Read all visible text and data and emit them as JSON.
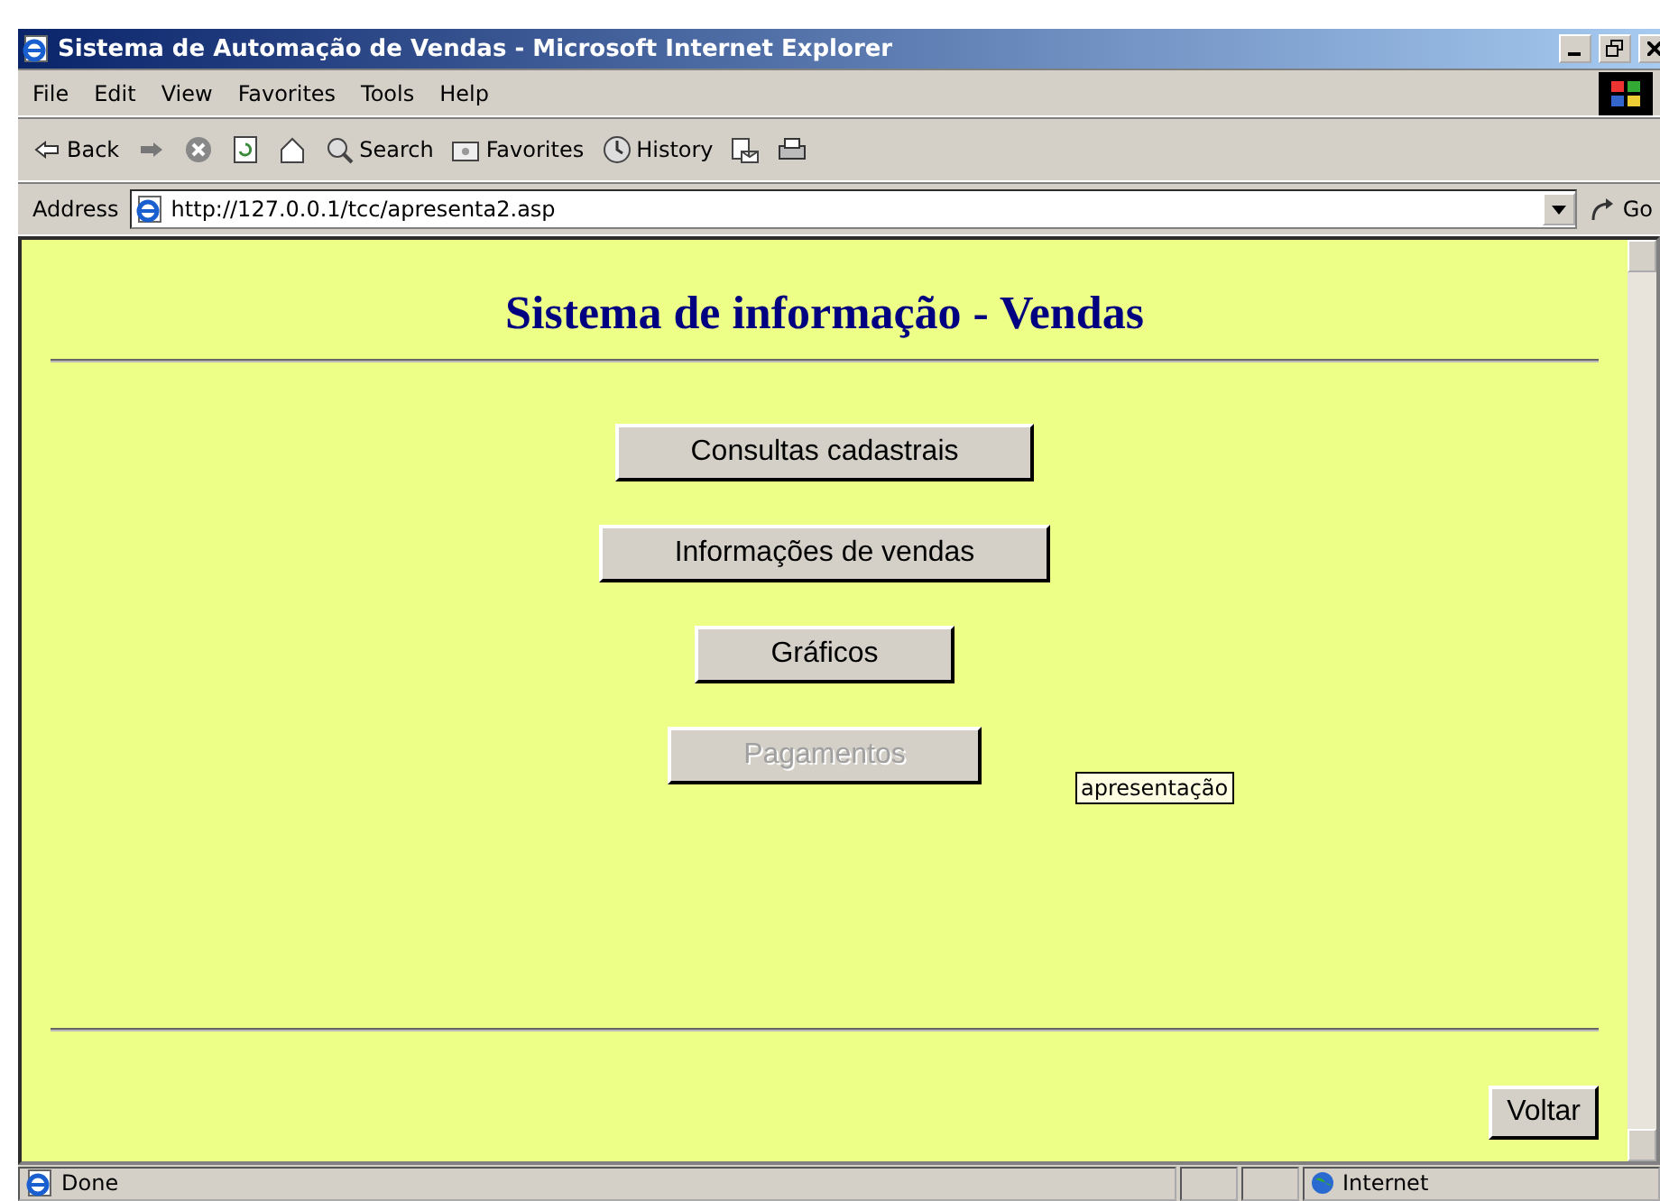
{
  "window": {
    "title": "Sistema de Automação de Vendas - Microsoft Internet Explorer"
  },
  "menu": [
    "File",
    "Edit",
    "View",
    "Favorites",
    "Tools",
    "Help"
  ],
  "toolbar": [
    {
      "kind": "back",
      "label": "Back"
    },
    {
      "kind": "forward"
    },
    {
      "kind": "stop"
    },
    {
      "kind": "refresh"
    },
    {
      "kind": "home"
    },
    {
      "kind": "search",
      "label": "Search"
    },
    {
      "kind": "favorites",
      "label": "Favorites"
    },
    {
      "kind": "history",
      "label": "History"
    },
    {
      "kind": "mail"
    },
    {
      "kind": "print"
    }
  ],
  "address": {
    "label": "Address",
    "value": "http://127.0.0.1/tcc/apresenta2.asp",
    "go": "Go"
  },
  "page": {
    "heading": "Sistema de informação - Vendas",
    "buttons": [
      {
        "label": "Consultas cadastrais",
        "disabled": false
      },
      {
        "label": "Informações de vendas",
        "disabled": false
      },
      {
        "label": "Gráficos",
        "disabled": false
      },
      {
        "label": "Pagamentos",
        "disabled": true
      }
    ],
    "tooltip": "apresentação",
    "back_button": "Voltar"
  },
  "status_bar": {
    "text": "Done",
    "zone": "Internet"
  }
}
